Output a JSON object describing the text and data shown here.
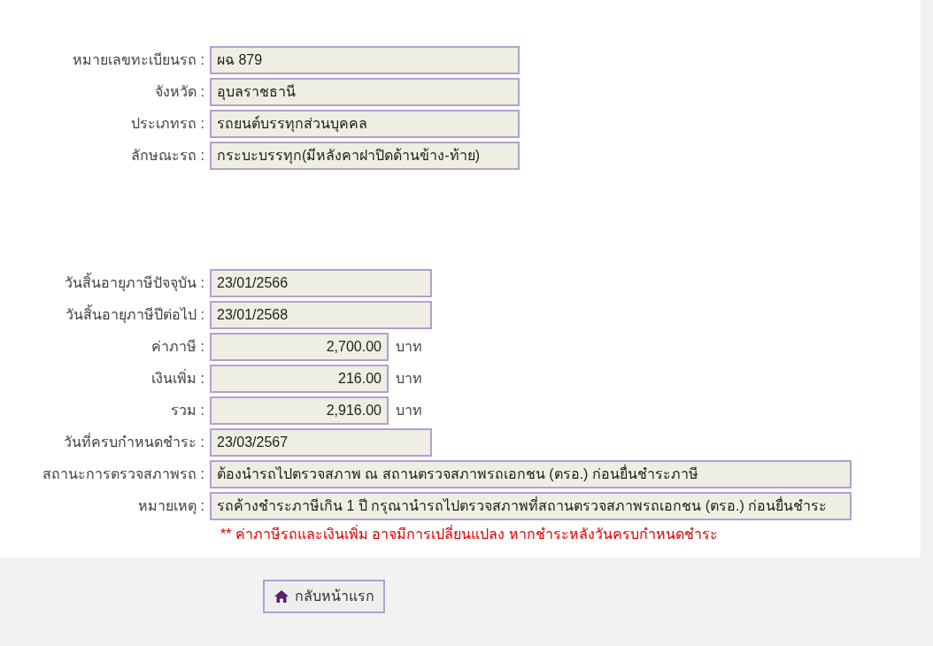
{
  "vehicle_fields": [
    {
      "label": "หมายเลขทะเบียนรถ :",
      "value": "ผฉ 879",
      "kind": "medium"
    },
    {
      "label": "จังหวัด :",
      "value": "อุบลราชธานี",
      "kind": "medium"
    },
    {
      "label": "ประเภทรถ :",
      "value": "รถยนต์บรรทุกส่วนบุคคล",
      "kind": "medium"
    },
    {
      "label": "ลักษณะรถ :",
      "value": "กระบะบรรทุก(มีหลังคาฝาปิดด้านข้าง-ท้าย)",
      "kind": "medium"
    }
  ],
  "tax_fields": [
    {
      "label": "วันสิ้นอายุภาษีปัจจุบัน :",
      "value": "23/01/2566",
      "kind": "date"
    },
    {
      "label": "วันสิ้นอายุภาษีปีต่อไป :",
      "value": "23/01/2568",
      "kind": "date"
    },
    {
      "label": "ค่าภาษี :",
      "value": "2,700.00",
      "kind": "amount",
      "unit": "บาท"
    },
    {
      "label": "เงินเพิ่ม :",
      "value": "216.00",
      "kind": "amount",
      "unit": "บาท"
    },
    {
      "label": "รวม :",
      "value": "2,916.00",
      "kind": "amount",
      "unit": "บาท"
    },
    {
      "label": "วันที่ครบกำหนดชำระ :",
      "value": "23/03/2567",
      "kind": "date"
    },
    {
      "label": "สถานะการตรวจสภาพรถ :",
      "value": "ต้องนำรถไปตรวจสภาพ ณ สถานตรวจสภาพรถเอกชน (ตรอ.) ก่อนยื่นชำระภาษี",
      "kind": "wide"
    },
    {
      "label": "หมายเหตุ :",
      "value": "รถค้างชำระภาษีเกิน 1 ปี กรุณานำรถไปตรวจสภาพที่สถานตรวจสภาพรถเอกชน (ตรอ.) ก่อนยื่นชำระ",
      "kind": "wide"
    }
  ],
  "warning": "** ค่าภาษีรถและเงินเพิ่ม อาจมีการเปลี่ยนแปลง หากชำระหลังวันครบกำหนดชำระ",
  "home_button": "กลับหน้าแรก"
}
